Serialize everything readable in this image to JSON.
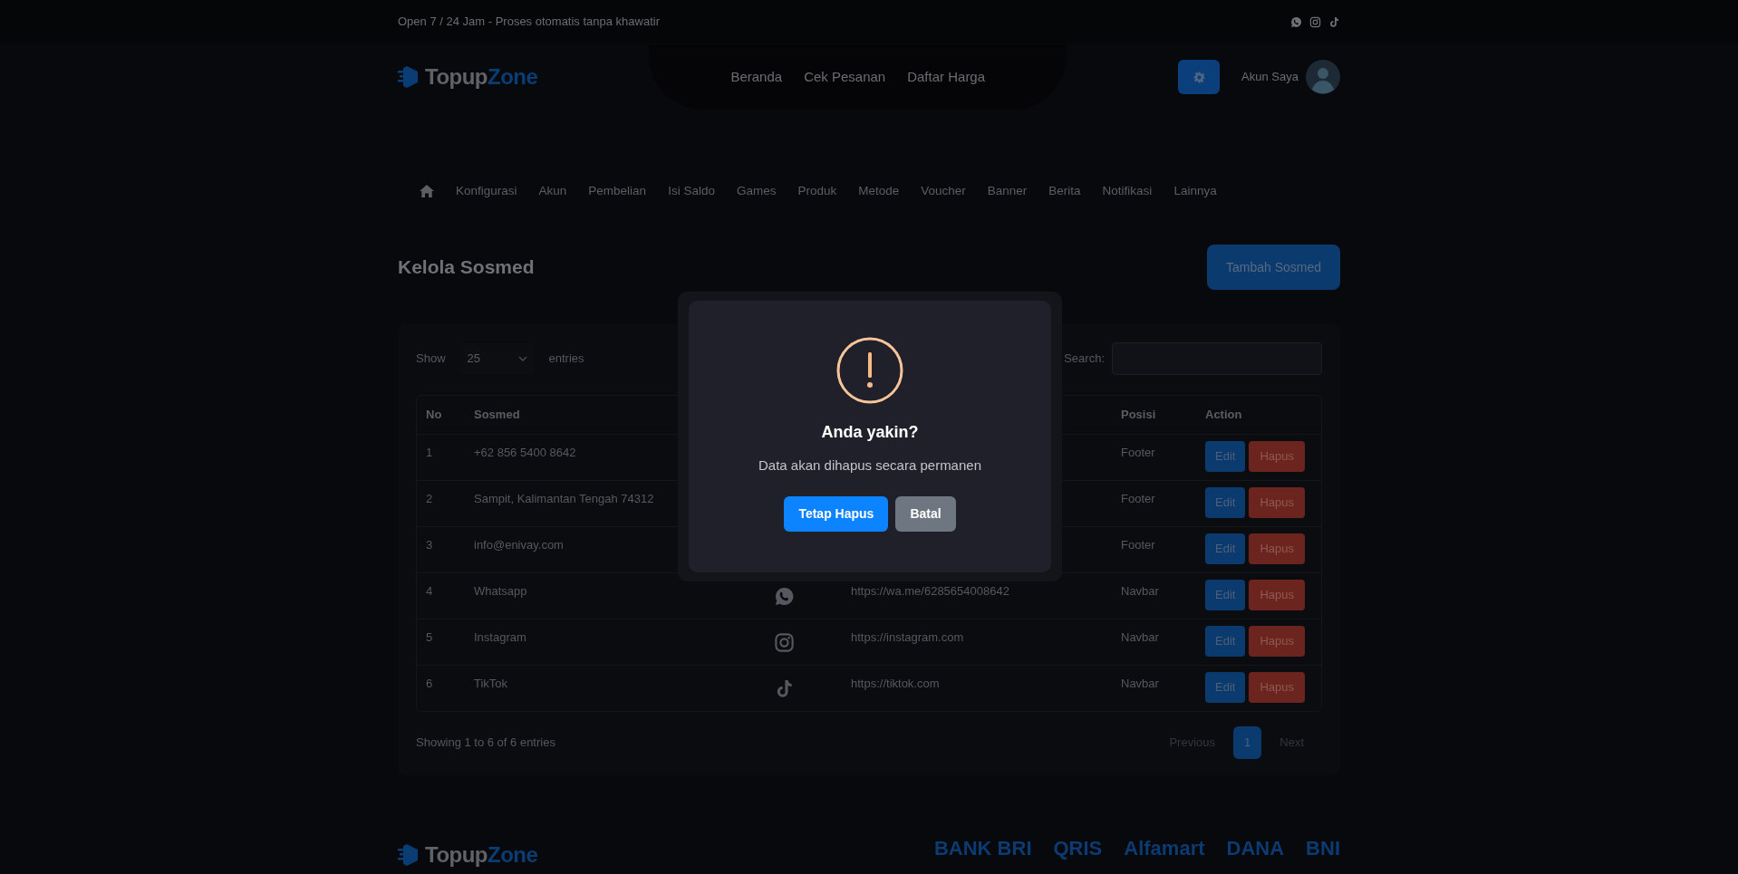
{
  "top_bar": {
    "tagline": "Open 7 / 24 Jam - Proses otomatis tanpa khawatir",
    "social_icons": [
      {
        "kind": "whatsapp"
      },
      {
        "kind": "instagram"
      },
      {
        "kind": "tiktok"
      }
    ]
  },
  "navbar": {
    "logo": {
      "part_1": "Topup",
      "part_2": "Zone"
    },
    "links": [
      "Beranda",
      "Cek Pesanan",
      "Daftar Harga"
    ],
    "account_label": "Akun Saya"
  },
  "admin_menu": [
    "Konfigurasi",
    "Akun",
    "Pembelian",
    "Isi Saldo",
    "Games",
    "Produk",
    "Metode",
    "Voucher",
    "Banner",
    "Berita",
    "Notifikasi",
    "Lainnya"
  ],
  "page": {
    "title": "Kelola Sosmed",
    "add_button": "Tambah Sosmed"
  },
  "table_controls": {
    "show_label": "Show",
    "page_length": "25",
    "entries_label": "entries",
    "search_label": "Search:"
  },
  "table": {
    "columns": [
      {
        "label": "No"
      },
      {
        "label": "Sosmed"
      },
      {},
      {},
      {
        "label": "Posisi"
      },
      {
        "label": "Action"
      }
    ],
    "rows": [
      {
        "no": "1",
        "sosmed": "+62 856 5400 8642",
        "posisi": "Footer",
        "actions": [
          "Edit",
          "Hapus"
        ]
      },
      {
        "no": "2",
        "sosmed": "Sampit, Kalimantan Tengah 74312",
        "posisi": "Footer",
        "actions": [
          "Edit",
          "Hapus"
        ]
      },
      {
        "no": "3",
        "sosmed": "info@enivay.com",
        "posisi": "Footer",
        "actions": [
          "Edit",
          "Hapus"
        ]
      },
      {
        "no": "4",
        "sosmed": "Whatsapp",
        "kind": "whatsapp",
        "link": "https://wa.me/6285654008642",
        "posisi": "Navbar",
        "actions": [
          "Edit",
          "Hapus"
        ]
      },
      {
        "no": "5",
        "sosmed": "Instagram",
        "kind": "instagram",
        "link": "https://instagram.com",
        "posisi": "Navbar",
        "actions": [
          "Edit",
          "Hapus"
        ]
      },
      {
        "no": "6",
        "sosmed": "TikTok",
        "kind": "tiktok",
        "link": "https://tiktok.com",
        "posisi": "Navbar",
        "actions": [
          "Edit",
          "Hapus"
        ]
      }
    ]
  },
  "table_footer": {
    "info": "Showing 1 to 6 of 6 entries",
    "pagination": [
      {
        "label": "Previous",
        "selected": false
      },
      {
        "label": "1",
        "selected": true
      },
      {
        "label": "Next",
        "selected": false
      }
    ]
  },
  "modal": {
    "title": "Anda yakin?",
    "text": "Data akan dihapus secara permanen",
    "buttons": [
      {
        "label": "Tetap Hapus",
        "kind": "confirm"
      },
      {
        "label": "Batal",
        "kind": "cancel"
      }
    ]
  },
  "footer": {
    "logo": {
      "part_1": "Topup",
      "part_2": "Zone"
    },
    "payments": [
      "BANK BRI",
      "QRIS",
      "Alfamart",
      "DANA",
      "BNI"
    ]
  }
}
